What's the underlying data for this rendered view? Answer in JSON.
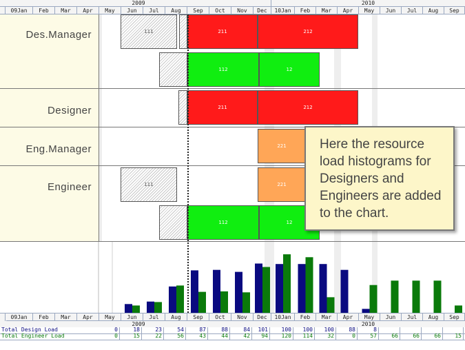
{
  "header": {
    "years": [
      "2009",
      "2010"
    ],
    "months": [
      "09Jan",
      "Feb",
      "Mar",
      "Apr",
      "May",
      "Jun",
      "Jul",
      "Aug",
      "Sep",
      "Oct",
      "Nov",
      "Dec",
      "10Jan",
      "Feb",
      "Mar",
      "Apr",
      "May",
      "Jun",
      "Jul",
      "Aug",
      "Sep"
    ]
  },
  "rows": [
    {
      "label": "Des.Manager"
    },
    {
      "label": "Designer"
    },
    {
      "label": "Eng.Manager"
    },
    {
      "label": "Engineer"
    }
  ],
  "tasks": {
    "t111a": "111",
    "t211a": "211",
    "t212a": "212",
    "t112a": "112",
    "t12a": "12",
    "t211b": "211",
    "t212b": "212",
    "t221a": "221",
    "t111b": "111",
    "t221b": "221",
    "t112b": "112",
    "t12b": "12"
  },
  "callout": {
    "text": "Here the resource load histograms for Designers and Engineers are added to the chart."
  },
  "colors": {
    "design_load": "#0a0a80",
    "engineer_load": "#0a7a0a",
    "task_red": "#ff1a1a",
    "task_green": "#10ee10",
    "task_orange": "#ffa657"
  },
  "chart_data": {
    "type": "bar",
    "categories": [
      "May",
      "Jun",
      "Jul",
      "Aug",
      "Sep",
      "Oct",
      "Nov",
      "Dec",
      "10Jan",
      "Feb",
      "Mar",
      "Apr",
      "May",
      "Jun",
      "Jul",
      "Aug",
      "Sep"
    ],
    "series": [
      {
        "name": "Total Design Load",
        "values": [
          0,
          18,
          23,
          54,
          87,
          88,
          84,
          101,
          100,
          100,
          100,
          88,
          8,
          null,
          null,
          null,
          null
        ]
      },
      {
        "name": "Total Engineer Load",
        "values": [
          0,
          15,
          22,
          56,
          43,
          44,
          42,
          94,
          120,
          114,
          32,
          0,
          57,
          66,
          66,
          66,
          15
        ]
      }
    ]
  }
}
